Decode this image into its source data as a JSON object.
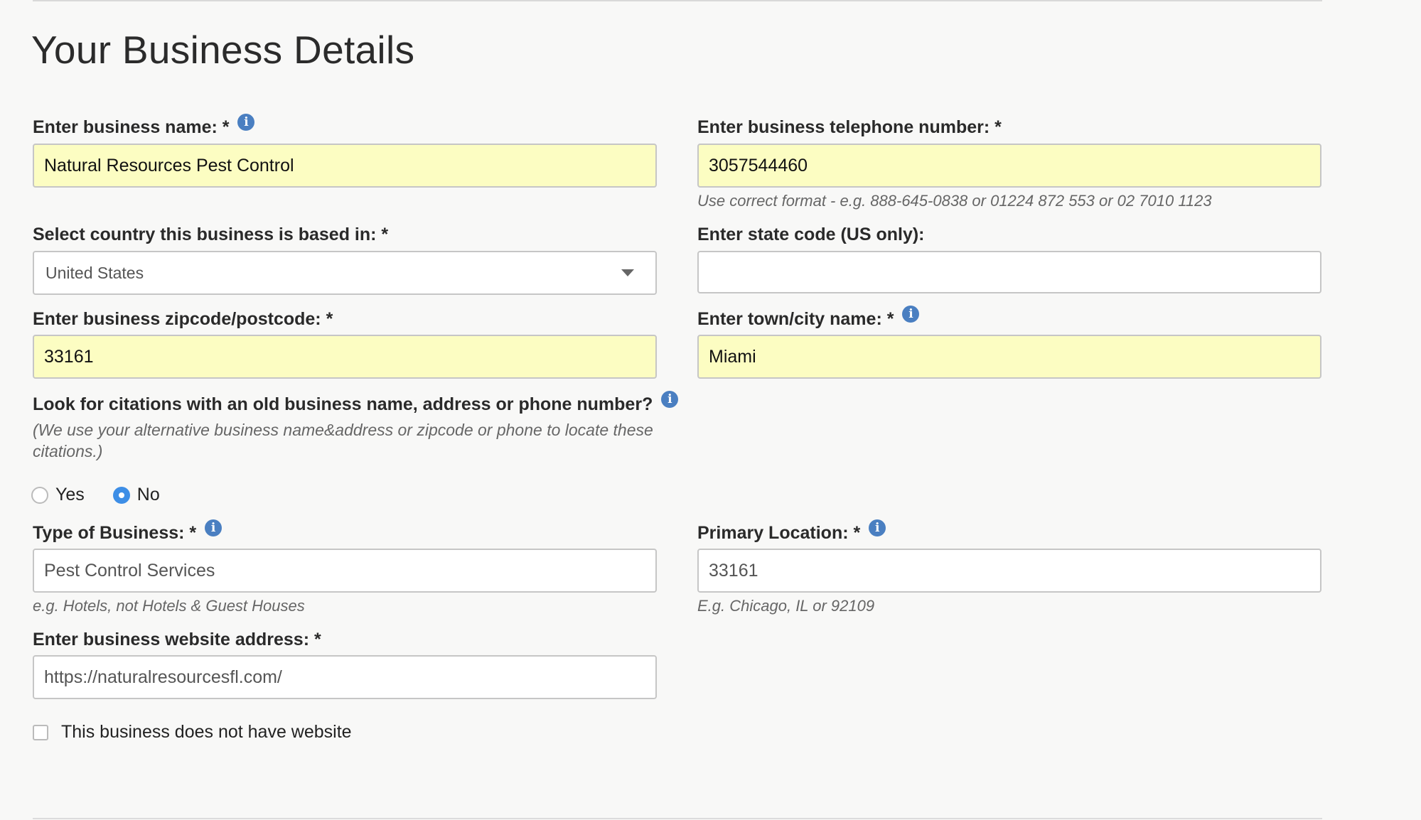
{
  "page": {
    "title": "Your Business Details"
  },
  "business_name": {
    "label": "Enter business name: *",
    "value": "Natural Resources Pest Control"
  },
  "telephone": {
    "label": "Enter business telephone number: *",
    "value": "3057544460",
    "hint": "Use correct format - e.g. 888-645-0838 or 01224 872 553 or 02 7010 1123"
  },
  "country": {
    "label": "Select country this business is based in: *",
    "selected": "United States"
  },
  "state_code": {
    "label": "Enter state code (US only):",
    "value": ""
  },
  "zipcode": {
    "label": "Enter business zipcode/postcode: *",
    "value": "33161"
  },
  "city": {
    "label": "Enter town/city name: *",
    "value": "Miami"
  },
  "citations": {
    "question": "Look for citations with an old business name, address or phone number?",
    "note_line1": "(We use your alternative business name&address or zipcode or phone to locate these",
    "note_line2": "citations.)",
    "options": [
      {
        "label": "Yes",
        "checked": false
      },
      {
        "label": "No",
        "checked": true
      }
    ]
  },
  "business_type": {
    "label": "Type of Business: *",
    "value": "Pest Control Services",
    "hint": "e.g. Hotels, not Hotels & Guest Houses"
  },
  "primary_location": {
    "label": "Primary Location: *",
    "value": "33161",
    "hint": "E.g. Chicago, IL or 92109"
  },
  "website": {
    "label": "Enter business website address: *",
    "value": "https://naturalresourcesfl.com/"
  },
  "no_website": {
    "label": "This business does not have website",
    "checked": false
  },
  "icons": {
    "info": "info-icon",
    "dropdown": "chevron-down-icon"
  },
  "colors": {
    "filled_field": "#fcfdc2",
    "info_icon": "#4a7fc1",
    "radio_checked": "#3d8ee6"
  }
}
